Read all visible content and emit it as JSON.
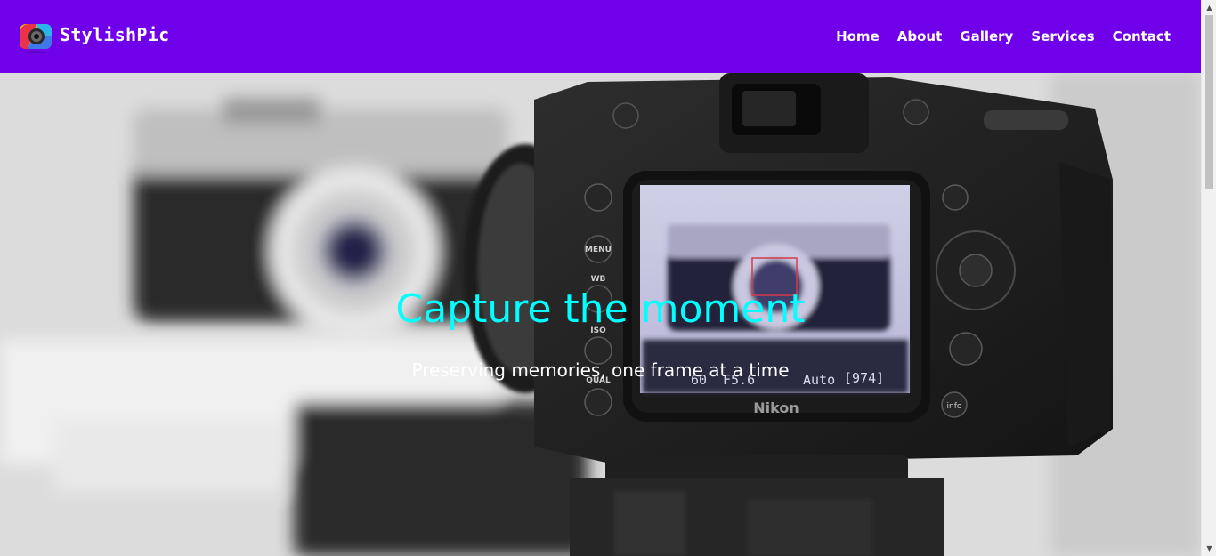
{
  "brand": {
    "name": "StylishPic",
    "logo_icon": "camera-logo-icon"
  },
  "nav": {
    "items": [
      {
        "label": "Home"
      },
      {
        "label": "About"
      },
      {
        "label": "Gallery"
      },
      {
        "label": "Services"
      },
      {
        "label": "Contact"
      }
    ]
  },
  "hero": {
    "title": "Capture the moment",
    "subtitle": "Preserving memories, one frame at a time",
    "image": "camera-photo",
    "camera_brand": "Nikon",
    "camera_buttons": [
      "MENU",
      "WB",
      "ISO",
      "QUAL",
      "info"
    ],
    "screen_readout": {
      "shutter": "60",
      "aperture": "F5.6",
      "mode": "Auto",
      "shots": "[974]"
    }
  },
  "colors": {
    "header_bg": "#7000ea",
    "nav_text": "#ffffff",
    "title": "#00ffff",
    "subtitle": "#ffffff"
  },
  "scrollbar": {
    "up_icon": "scroll-up-arrow-icon",
    "down_icon": "scroll-down-arrow-icon"
  }
}
